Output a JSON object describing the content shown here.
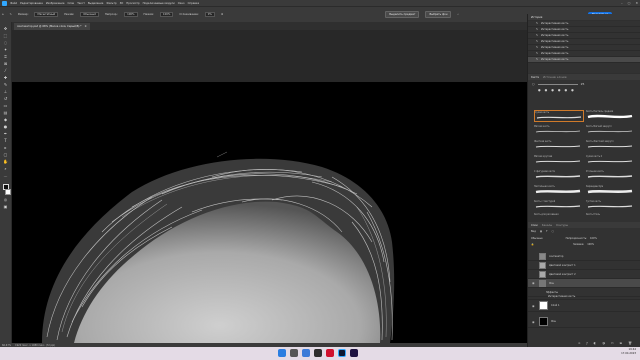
{
  "app": {
    "menu": [
      "Файл",
      "Редактирование",
      "Изображение",
      "Слои",
      "Текст",
      "Выделение",
      "Фильтр",
      "3D",
      "Просмотр",
      "Подключаемые модули",
      "Окно",
      "Справка"
    ]
  },
  "window_controls": {
    "minimize": "–",
    "maximize": "▢",
    "close": "✕"
  },
  "options": {
    "size_label": "Размер:",
    "size_value": "Масштабный",
    "mode_label": "Режим:",
    "mode_value": "Обычный",
    "opacity_label": "Непрозр.:",
    "opacity_value": "100%",
    "flow_label": "Нажим:",
    "flow_value": "100%",
    "smoothing_label": "Сглаживание:",
    "smoothing_value": "0%",
    "select_subject_button": "Выделить предмет",
    "select_mask_button": "Выбрать фон",
    "share_button": "Поделиться"
  },
  "document": {
    "tab_title": "синтезатор.psd @ 66% (Маска слоя, Серый/8) *"
  },
  "statusbar": {
    "zoom": "66,67%",
    "info": "1920 пикс. x 1080 пикс. (72 ppi)"
  },
  "history": {
    "title": "История",
    "items": [
      "Интерактивная кисть",
      "Интерактивная кисть",
      "Интерактивная кисть",
      "Интерактивная кисть",
      "Интерактивная кисть",
      "Интерактивная кисть",
      "Интерактивная кисть"
    ]
  },
  "brushes": {
    "tabs": [
      "Кисти",
      "Источник клонов"
    ],
    "size_value": "25",
    "items": [
      {
        "name": "Сухая кисть"
      },
      {
        "name": "Кисть Пастель средняя"
      },
      {
        "name": "Мягкая кисть"
      },
      {
        "name": "Кисть Мягкий закругл"
      },
      {
        "name": "Жесткая кисть"
      },
      {
        "name": "Кисть Жесткий закругл"
      },
      {
        "name": "Мягкая круглая"
      },
      {
        "name": "Сухая кисть 2"
      },
      {
        "name": "С фигурами кисти"
      },
      {
        "name": "Угольная кисть"
      },
      {
        "name": "Пастельная кисть"
      },
      {
        "name": "Карандаш Kyle"
      },
      {
        "name": "Кисть с текстурой"
      },
      {
        "name": "Густая кисть"
      },
      {
        "name": "Кисть для рисования"
      },
      {
        "name": "Кисть Уголь"
      }
    ]
  },
  "layers": {
    "tabs": [
      "Слои",
      "Каналы",
      "Контуры"
    ],
    "filter_label": "Вид",
    "blend_mode": "Обычные",
    "opacity_label": "Непрозрачность:",
    "opacity_value": "100%",
    "fill_label": "Заливка:",
    "fill_value": "100%",
    "items": [
      {
        "name": "синтезатор"
      },
      {
        "name": "Цветовой контраст 1"
      },
      {
        "name": "Цветовой контраст 2"
      },
      {
        "name": "Фон"
      },
      {
        "name": "Эффекты"
      },
      {
        "name": "Интерактивная кисть"
      },
      {
        "name": "Слой 1"
      },
      {
        "name": "Фон"
      }
    ]
  },
  "taskbar": {
    "time": "19:44",
    "date": "17.04.2023"
  },
  "colors": {
    "accent": "#1473e6",
    "panel": "#323232",
    "brush_highlight": "#d07a2a"
  }
}
